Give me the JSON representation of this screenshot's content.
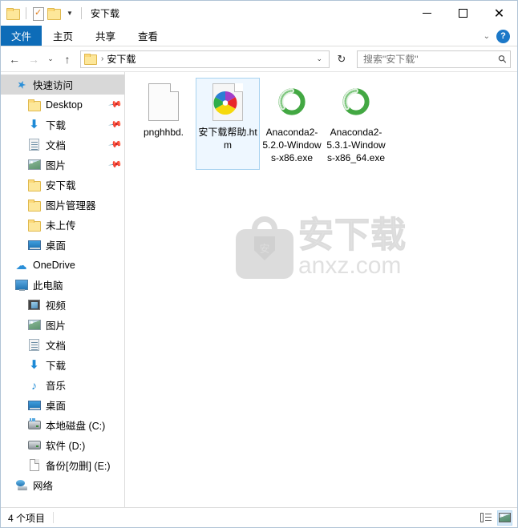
{
  "window": {
    "title": "安下载",
    "quick_access_toolbar": [
      {
        "name": "folder-icon",
        "label": ""
      },
      {
        "name": "properties-icon",
        "label": ""
      },
      {
        "name": "new-folder-icon",
        "label": ""
      },
      {
        "name": "customize-caret-icon",
        "label": "▼"
      }
    ],
    "controls": {
      "minimize": "—",
      "maximize": "▢",
      "close": "✕"
    }
  },
  "ribbon": {
    "tabs": [
      {
        "label": "文件",
        "selected": true
      },
      {
        "label": "主页",
        "selected": false
      },
      {
        "label": "共享",
        "selected": false
      },
      {
        "label": "查看",
        "selected": false
      }
    ],
    "expand_caret": "⌄",
    "help_label": "?"
  },
  "address_bar": {
    "back": "←",
    "forward": "→",
    "recent_caret": "⌄",
    "up": "↑",
    "breadcrumb": {
      "separator": "›",
      "path": "安下载"
    },
    "dropdown_caret": "⌄",
    "refresh": "↻"
  },
  "search": {
    "placeholder": "搜索\"安下载\"",
    "icon": "search-icon"
  },
  "sidebar": {
    "items": [
      {
        "label": "快速访问",
        "icon": "star-icon",
        "level": 0,
        "selected": true,
        "pinned": false
      },
      {
        "label": "Desktop",
        "icon": "folder-icon",
        "level": 1,
        "selected": false,
        "pinned": true
      },
      {
        "label": "下载",
        "icon": "download-icon",
        "level": 1,
        "selected": false,
        "pinned": true
      },
      {
        "label": "文档",
        "icon": "documents-icon",
        "level": 1,
        "selected": false,
        "pinned": true
      },
      {
        "label": "图片",
        "icon": "pictures-icon",
        "level": 1,
        "selected": false,
        "pinned": true
      },
      {
        "label": "安下载",
        "icon": "folder-icon",
        "level": 1,
        "selected": false,
        "pinned": false
      },
      {
        "label": "图片管理器",
        "icon": "folder-icon",
        "level": 1,
        "selected": false,
        "pinned": false
      },
      {
        "label": "未上传",
        "icon": "folder-icon",
        "level": 1,
        "selected": false,
        "pinned": false
      },
      {
        "label": "桌面",
        "icon": "desktop-icon",
        "level": 1,
        "selected": false,
        "pinned": false
      },
      {
        "label": "OneDrive",
        "icon": "cloud-icon",
        "level": 0,
        "selected": false,
        "pinned": false
      },
      {
        "label": "此电脑",
        "icon": "this-pc-icon",
        "level": 0,
        "selected": false,
        "pinned": false
      },
      {
        "label": "视频",
        "icon": "video-icon",
        "level": 1,
        "selected": false,
        "pinned": false
      },
      {
        "label": "图片",
        "icon": "pictures-icon",
        "level": 1,
        "selected": false,
        "pinned": false
      },
      {
        "label": "文档",
        "icon": "documents-icon",
        "level": 1,
        "selected": false,
        "pinned": false
      },
      {
        "label": "下载",
        "icon": "download-icon",
        "level": 1,
        "selected": false,
        "pinned": false
      },
      {
        "label": "音乐",
        "icon": "music-icon",
        "level": 1,
        "selected": false,
        "pinned": false
      },
      {
        "label": "桌面",
        "icon": "desktop-icon",
        "level": 1,
        "selected": false,
        "pinned": false
      },
      {
        "label": "本地磁盘 (C:)",
        "icon": "system-drive-icon",
        "level": 1,
        "selected": false,
        "pinned": false
      },
      {
        "label": "软件 (D:)",
        "icon": "drive-icon",
        "level": 1,
        "selected": false,
        "pinned": false
      },
      {
        "label": "备份[勿删] (E:)",
        "icon": "blank-drive-icon",
        "level": 1,
        "selected": false,
        "pinned": false
      },
      {
        "label": "网络",
        "icon": "network-icon",
        "level": 0,
        "selected": false,
        "pinned": false
      }
    ]
  },
  "files": [
    {
      "name": "pnghhbd.",
      "icon": "blank-page-icon",
      "selected": false
    },
    {
      "name": "安下载帮助.htm",
      "icon": "html-page-icon",
      "selected": true
    },
    {
      "name": "Anaconda2-5.2.0-Windows-x86.exe",
      "icon": "anaconda-icon",
      "selected": false
    },
    {
      "name": "Anaconda2-5.3.1-Windows-x86_64.exe",
      "icon": "anaconda-icon",
      "selected": false
    }
  ],
  "watermark": {
    "cn_text": "安下载",
    "en_text": "anxz.com",
    "shield_char": "安"
  },
  "status_bar": {
    "item_count": "4 个项目",
    "views": [
      {
        "name": "details-view-icon",
        "active": false
      },
      {
        "name": "large-icons-view-icon",
        "active": true
      }
    ]
  },
  "colors": {
    "accent": "#0d6cb8",
    "selection": "#cce8ff",
    "anaconda_green": "#43a843",
    "watermark_gray": "#e2e2e2"
  }
}
